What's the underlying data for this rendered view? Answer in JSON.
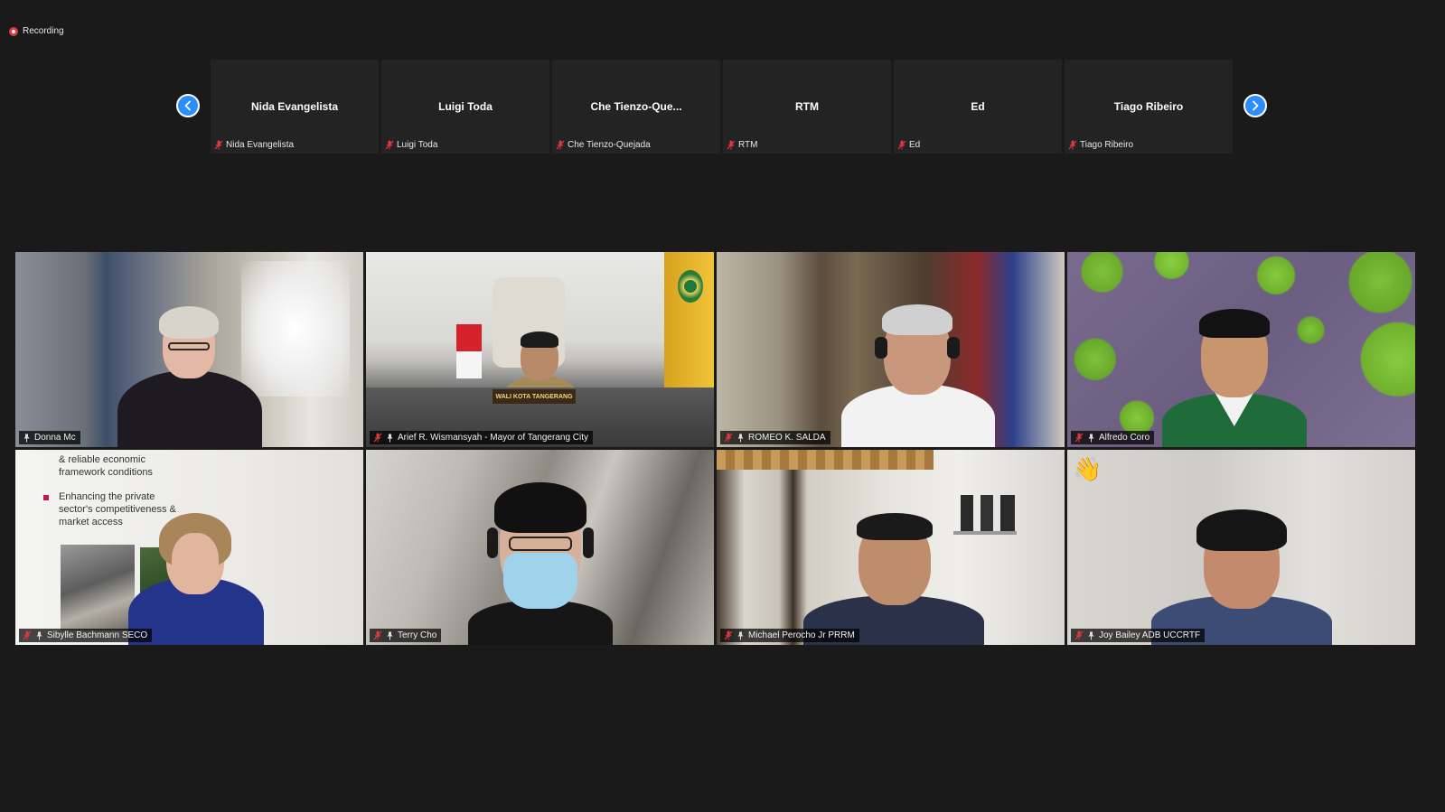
{
  "recording": {
    "label": "Recording"
  },
  "strip": {
    "participants": [
      {
        "display": "Nida Evangelista",
        "label": "Nida Evangelista"
      },
      {
        "display": "Luigi Toda",
        "label": "Luigi Toda"
      },
      {
        "display": "Che  Tienzo-Que...",
        "label": "Che Tienzo-Quejada"
      },
      {
        "display": "RTM",
        "label": "RTM"
      },
      {
        "display": "Ed",
        "label": "Ed"
      },
      {
        "display": "Tiago Ribeiro",
        "label": "Tiago Ribeiro"
      }
    ]
  },
  "grid": {
    "tiles": [
      {
        "label": "Donna Mc",
        "active": true
      },
      {
        "label": "Arief R. Wismansyah - Mayor of Tangerang City"
      },
      {
        "label": "ROMEO K. SALDA"
      },
      {
        "label": "Alfredo Coro"
      },
      {
        "label": "Sibylle Bachmann SECO"
      },
      {
        "label": "Terry Cho"
      },
      {
        "label": "Michael Perocho Jr PRRM"
      },
      {
        "label": "Joy Bailey ADB UCCRTF",
        "reaction": "👋"
      }
    ],
    "slide": {
      "line1": "& reliable economic",
      "line2": "framework conditions",
      "line3": "Enhancing the private",
      "line4": "sector's competitiveness &",
      "line5": "market access"
    },
    "nameplate": {
      "line1": "WALI KOTA TANGERANG"
    }
  },
  "colors": {
    "background": "#1a1a1a",
    "tile": "#232323",
    "active_outline": "#e5f13a",
    "nav_arrow": "#2d8cff",
    "muted": "#e0393e"
  }
}
